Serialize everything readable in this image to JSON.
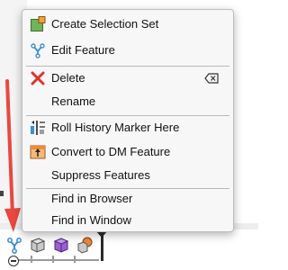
{
  "context_menu": {
    "items": [
      {
        "label": "Create Selection Set",
        "icon": "selection-set-icon"
      },
      {
        "label": "Edit Feature",
        "icon": "edit-feature-icon"
      },
      {
        "label": "Delete",
        "icon": "delete-x-icon",
        "shortcut_icon": "delete-key-icon"
      },
      {
        "label": "Rename"
      },
      {
        "label": "Roll History Marker Here",
        "icon": "roll-history-icon"
      },
      {
        "label": "Convert to DM Feature",
        "icon": "convert-dm-icon"
      },
      {
        "label": "Suppress Features"
      },
      {
        "label": "Find in Browser"
      },
      {
        "label": "Find in Window"
      }
    ]
  },
  "timeline": {
    "icons": [
      "feature-fork-icon",
      "body-gray-icon",
      "body-purple-icon",
      "body-orange-icon"
    ],
    "marker_icon": "roll-marker-icon",
    "collapse_icon": "minus-circle-icon"
  },
  "annotation": {
    "arrow_color": "#e8483f"
  },
  "colors": {
    "menu_bg": "#f7f7f7",
    "delete_red": "#e0312b",
    "fork_blue": "#3a8fd0"
  }
}
